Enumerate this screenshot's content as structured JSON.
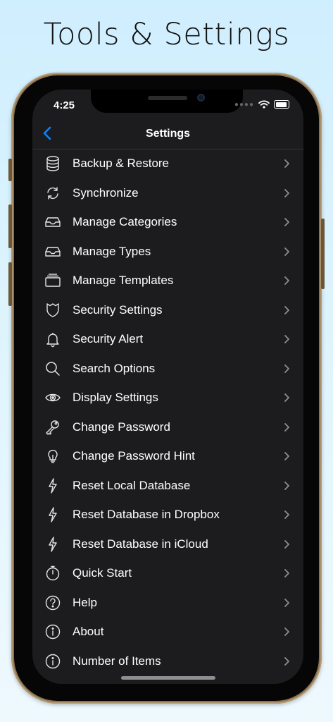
{
  "headline": "Tools & Settings",
  "status": {
    "time": "4:25"
  },
  "nav": {
    "title": "Settings",
    "back_icon": "chevron-left-icon"
  },
  "colors": {
    "accent": "#0a84ff",
    "background": "#1c1c1e",
    "text": "#ffffff",
    "chevron": "#8e8e93"
  },
  "menu": [
    {
      "label": "Backup & Restore",
      "icon": "database-icon"
    },
    {
      "label": "Synchronize",
      "icon": "sync-icon"
    },
    {
      "label": "Manage Categories",
      "icon": "inbox-tray-icon"
    },
    {
      "label": "Manage Types",
      "icon": "inbox-tray-icon"
    },
    {
      "label": "Manage Templates",
      "icon": "stack-icon"
    },
    {
      "label": "Security Settings",
      "icon": "shield-icon"
    },
    {
      "label": "Security Alert",
      "icon": "bell-icon"
    },
    {
      "label": "Search Options",
      "icon": "search-icon"
    },
    {
      "label": "Display Settings",
      "icon": "eye-icon"
    },
    {
      "label": "Change Password",
      "icon": "key-icon"
    },
    {
      "label": "Change Password Hint",
      "icon": "lightbulb-icon"
    },
    {
      "label": "Reset Local Database",
      "icon": "lightning-icon"
    },
    {
      "label": "Reset Database in Dropbox",
      "icon": "lightning-icon"
    },
    {
      "label": "Reset Database in iCloud",
      "icon": "lightning-icon"
    },
    {
      "label": "Quick Start",
      "icon": "stopwatch-icon"
    },
    {
      "label": "Help",
      "icon": "question-circle-icon"
    },
    {
      "label": "About",
      "icon": "info-circle-icon"
    },
    {
      "label": "Number of Items",
      "icon": "info-circle-icon"
    }
  ]
}
